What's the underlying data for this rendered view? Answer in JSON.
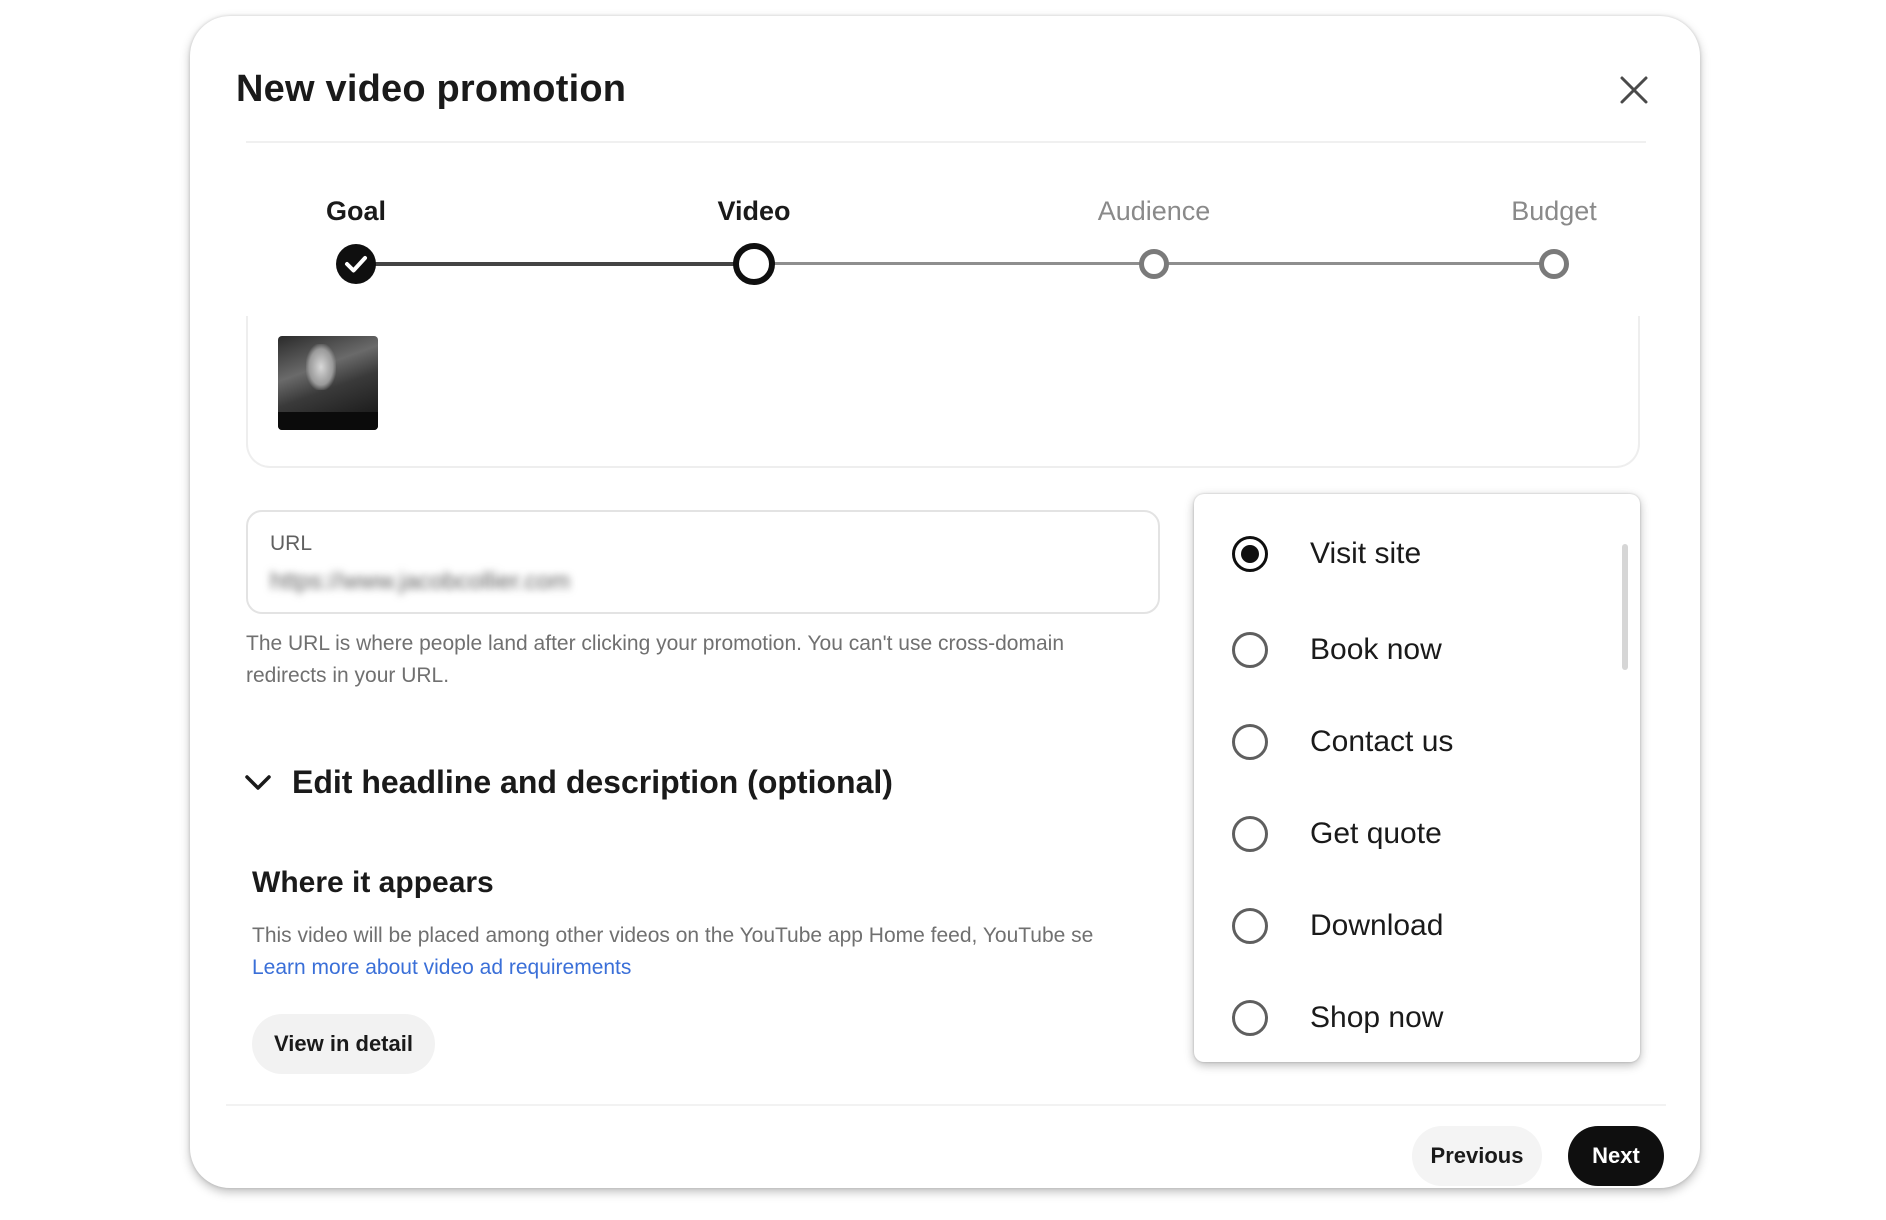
{
  "dialog": {
    "title": "New video promotion",
    "close_icon": "close-icon"
  },
  "stepper": {
    "steps": [
      {
        "label": "Goal",
        "state": "done"
      },
      {
        "label": "Video",
        "state": "current"
      },
      {
        "label": "Audience",
        "state": "future"
      },
      {
        "label": "Budget",
        "state": "future"
      }
    ]
  },
  "url_field": {
    "label": "URL",
    "value": "https://www.jacobcollier.com",
    "help_text": "The URL is where people land after clicking your promotion. You can't use cross-domain redirects in your URL."
  },
  "expander": {
    "icon": "chevron-down-icon",
    "label": "Edit headline and description (optional)"
  },
  "placement": {
    "title": "Where it appears",
    "text": "This video will be placed among other videos on the YouTube app Home feed, YouTube se",
    "link": "Learn more about video ad requirements",
    "detail_button": "View in detail"
  },
  "footer": {
    "previous": "Previous",
    "next": "Next"
  },
  "cta_dropdown": {
    "selected": "Visit site",
    "options": [
      "Visit site",
      "Book now",
      "Contact us",
      "Get quote",
      "Download",
      "Shop now"
    ]
  },
  "colors": {
    "primary": "#0f0f0f",
    "link": "#3a6fd8",
    "muted_text": "#707070",
    "inactive_step": "#8a8a8a"
  }
}
